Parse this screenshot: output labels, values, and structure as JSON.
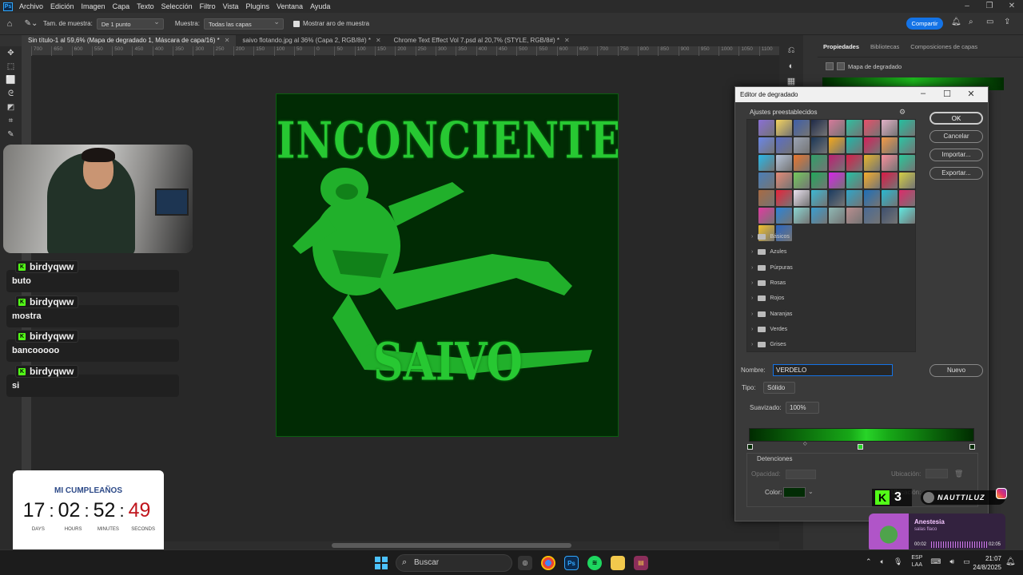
{
  "menubar": {
    "items": [
      "Archivo",
      "Edición",
      "Imagen",
      "Capa",
      "Texto",
      "Selección",
      "Filtro",
      "Vista",
      "Plugins",
      "Ventana",
      "Ayuda"
    ]
  },
  "options": {
    "sample_size_label": "Tam. de muestra:",
    "sample_size_value": "De 1 punto",
    "sample_label": "Muestra:",
    "sample_value": "Todas las capas",
    "show_ring_label": "Mostrar aro de muestra",
    "share_label": "Compartir"
  },
  "tabs": [
    {
      "label": "Sin título-1 al 59,6% (Mapa de degradado 1, Máscara de capa/16) *"
    },
    {
      "label": "saivo flotando.jpg al 36% (Capa 2, RGB/8#) *"
    },
    {
      "label": "Chrome Text Effect Vol 7.psd al 20,7% (STYLE, RGB/8#) *"
    }
  ],
  "ruler_marks": [
    "700",
    "650",
    "600",
    "550",
    "500",
    "450",
    "400",
    "350",
    "300",
    "250",
    "200",
    "150",
    "100",
    "50",
    "0",
    "50",
    "100",
    "150",
    "200",
    "250",
    "300",
    "350",
    "400",
    "450",
    "500",
    "550",
    "600",
    "650",
    "700",
    "750",
    "800",
    "850",
    "900",
    "950",
    "1000",
    "1050",
    "1100"
  ],
  "artwork": {
    "title": "INCONCIENTE",
    "subtitle": "SAIVO"
  },
  "panel": {
    "tabs": [
      "Propiedades",
      "Bibliotecas",
      "Composiciones de capas"
    ],
    "item": "Mapa de degradado"
  },
  "dialog": {
    "title": "Editor de degradado",
    "presets_label": "Ajustes preestablecidos",
    "folders": [
      "Básicos",
      "Azules",
      "Púrpuras",
      "Rosas",
      "Rojos",
      "Naranjas",
      "Verdes",
      "Grises"
    ],
    "buttons": {
      "ok": "OK",
      "cancel": "Cancelar",
      "import": "Importar...",
      "export": "Exportar...",
      "new": "Nuevo"
    },
    "name_label": "Nombre:",
    "name_value": "VERDELO",
    "type_label": "Tipo:",
    "type_value": "Sólido",
    "smooth_label": "Suavizado:",
    "smooth_value": "100%",
    "stops_label": "Detenciones",
    "opacity_label": "Opacidad:",
    "location_label": "Ubicación:",
    "color_label": "Color:",
    "location_label2": "Ubicación:",
    "color_value": "#022c05"
  },
  "swatch_colors": [
    "#8a6fd6",
    "#f4d35e",
    "#3f5fa8",
    "#1e2a48",
    "#d67a9a",
    "#2fbfa0",
    "#e84f6a",
    "#e2b0c6",
    "#24c0a0",
    "#6a86e8",
    "#5a6ec7",
    "#9aa3b4",
    "#1a3656",
    "#f3a81b",
    "#20b6a8",
    "#d3225a",
    "#f39a47",
    "#2bc4a3",
    "#28b8e8",
    "#b5c3d9",
    "#e9772e",
    "#2f9f68",
    "#bd1f73",
    "#d61f4a",
    "#e6b52d",
    "#f78e9b",
    "#2ac79a",
    "#4a7fb8",
    "#e58a76",
    "#74c95c",
    "#20a85a",
    "#d724e8",
    "#23c1a3",
    "#f6ad2c",
    "#db1a46",
    "#d4cf44",
    "#a86a43",
    "#e8233a",
    "#e9e1ee",
    "#3bb8d4",
    "#1b3b60",
    "#2fa5c8",
    "#1e6fb8",
    "#29b9d1",
    "#dd2b6a",
    "#e03ba0",
    "#2b84d8",
    "#8ad4d0",
    "#3a9ed0",
    "#8fb8b4",
    "#b98e8f",
    "#4a6a94",
    "#3d4f6e",
    "#60e8e0",
    "#f2c22c",
    "#2a66c2"
  ],
  "webcam": {},
  "chat": [
    {
      "user": "birdyqww",
      "msg": "buto"
    },
    {
      "user": "birdyqww",
      "msg": "mostra"
    },
    {
      "user": "birdyqww",
      "msg": "bancooooo"
    },
    {
      "user": "birdyqww",
      "msg": "si"
    }
  ],
  "countdown": {
    "title": "MI CUMPLEAÑOS",
    "days": "17",
    "hours": "02",
    "minutes": "52",
    "seconds": "49",
    "days_label": "DAYS",
    "hours_label": "HOURS",
    "minutes_label": "MINUTES",
    "seconds_label": "SECONDS"
  },
  "kick_count": "3",
  "handle": "NAUTTILUZ",
  "music": {
    "title": "Anestesia",
    "artist": "salas flaco",
    "elapsed": "00:02",
    "duration": "02:05"
  },
  "taskbar": {
    "search_placeholder": "Buscar",
    "lang_top": "ESP",
    "lang_bottom": "LAA",
    "time": "21:07",
    "date": "24/8/2025"
  },
  "colors": {
    "accent": "#1473e6",
    "kick_green": "#53fc18",
    "art_green": "#27c832"
  }
}
